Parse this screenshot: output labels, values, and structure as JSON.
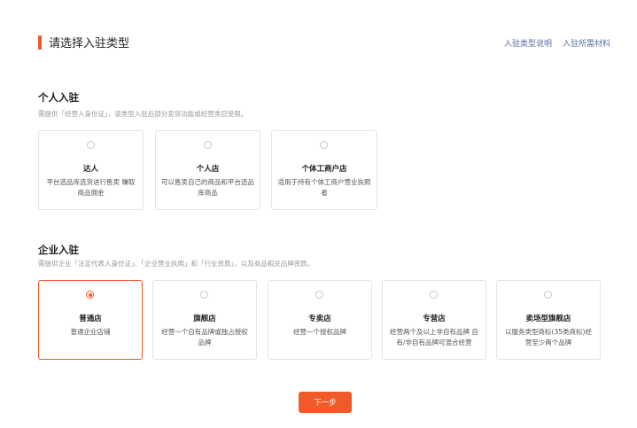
{
  "header": {
    "title": "请选择入驻类型",
    "links": [
      "入驻类型说明",
      "入驻所需材料"
    ]
  },
  "personal": {
    "title": "个人入驻",
    "desc": "需提供「经营人身份证」，该类型入驻后部分卖货功能或经营类目受限。",
    "cards": [
      {
        "title": "达人",
        "desc": "平台选品库选货进行售卖 赚取商品佣金"
      },
      {
        "title": "个人店",
        "desc": "可以售卖自己的商品和平台选品库商品"
      },
      {
        "title": "个体工商户店",
        "desc": "适用于持有个体工商户营业执照者"
      }
    ]
  },
  "enterprise": {
    "title": "企业入驻",
    "desc": "需提供企业「法定代表人身份证」、「企业营业执照」和「行业资质」，以及商品相关品牌资质。",
    "selected_index": 0,
    "cards": [
      {
        "title": "普通店",
        "desc": "普通企业店铺"
      },
      {
        "title": "旗舰店",
        "desc": "经营一个自有品牌或独占授权品牌"
      },
      {
        "title": "专卖店",
        "desc": "经营一个授权品牌"
      },
      {
        "title": "专营店",
        "desc": "经营两个及以上非自有品牌 自有/非自有品牌可混合经营"
      },
      {
        "title": "卖场型旗舰店",
        "desc": "以服务类型商标(35类商标)经营至少两个品牌"
      }
    ]
  },
  "footer": {
    "next_label": "下一步"
  },
  "colors": {
    "accent": "#f05a28",
    "link": "#5a6e9c"
  }
}
